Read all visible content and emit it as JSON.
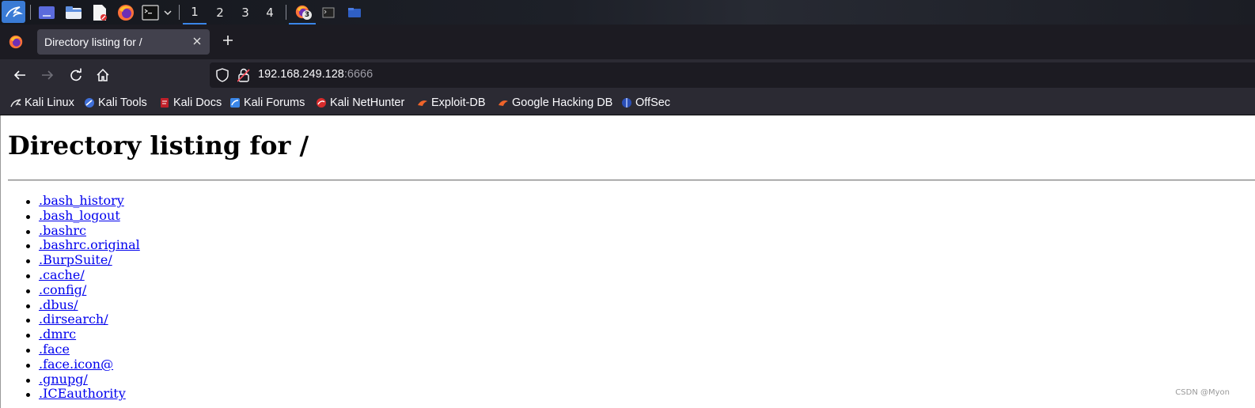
{
  "taskbar": {
    "workspaces": [
      "1",
      "2",
      "3",
      "4"
    ],
    "active_workspace": "1",
    "firefox_badge": "3",
    "accent_color": "#3a86e8"
  },
  "browser": {
    "tab_title": "Directory listing for /",
    "url_host": "192.168.249.128",
    "url_port": ":6666",
    "bookmarks": [
      {
        "label": "Kali Linux",
        "icon": "kali-dragon-icon"
      },
      {
        "label": "Kali Tools",
        "icon": "kali-tools-icon"
      },
      {
        "label": "Kali Docs",
        "icon": "kali-docs-icon"
      },
      {
        "label": "Kali Forums",
        "icon": "kali-forums-icon"
      },
      {
        "label": "Kali NetHunter",
        "icon": "kali-nethunter-icon"
      },
      {
        "label": "Exploit-DB",
        "icon": "exploit-db-icon"
      },
      {
        "label": "Google Hacking DB",
        "icon": "ghdb-icon"
      },
      {
        "label": "OffSec",
        "icon": "offsec-icon"
      }
    ]
  },
  "page": {
    "heading": "Directory listing for /",
    "files": [
      ".bash_history",
      ".bash_logout",
      ".bashrc",
      ".bashrc.original",
      ".BurpSuite/",
      ".cache/",
      ".config/",
      ".dbus/",
      ".dirsearch/",
      ".dmrc",
      ".face",
      ".face.icon@",
      ".gnupg/",
      ".ICEauthority"
    ],
    "link_color": "#0000ee"
  },
  "watermark": "CSDN @Myon⁠"
}
